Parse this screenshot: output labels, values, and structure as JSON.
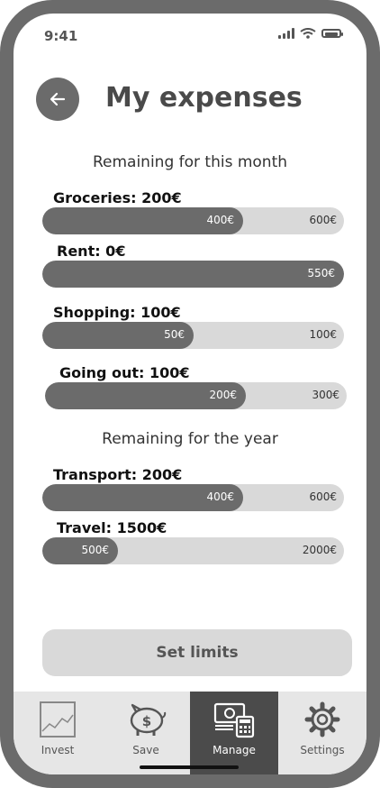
{
  "status_bar": {
    "time": "9:41"
  },
  "header": {
    "title": "My expenses"
  },
  "sections": [
    {
      "title": "Remaining for this month"
    },
    {
      "title": "Remaining for the year"
    }
  ],
  "expenses": [
    {
      "label": "Groceries: 200€",
      "used_label": "400€",
      "total_label": "600€",
      "used": 400,
      "total": 600
    },
    {
      "label": "Rent: 0€",
      "used_label": "550€",
      "total_label": "",
      "used": 550,
      "total": 550
    },
    {
      "label": "Shopping: 100€",
      "used_label": "50€",
      "total_label": "100€",
      "used": 50,
      "total": 100
    },
    {
      "label": "Going out: 100€",
      "used_label": "200€",
      "total_label": "300€",
      "used": 200,
      "total": 300
    },
    {
      "label": "Transport: 200€",
      "used_label": "400€",
      "total_label": "600€",
      "used": 400,
      "total": 600
    },
    {
      "label": "Travel: 1500€",
      "used_label": "500€",
      "total_label": "2000€",
      "used": 500,
      "total": 2000
    }
  ],
  "actions": {
    "set_limits_label": "Set limits"
  },
  "tabs": [
    {
      "label": "Invest",
      "icon": "chart-icon",
      "active": false
    },
    {
      "label": "Save",
      "icon": "piggy-bank-icon",
      "active": false
    },
    {
      "label": "Manage",
      "icon": "money-calculator-icon",
      "active": true
    },
    {
      "label": "Settings",
      "icon": "gear-icon",
      "active": false
    }
  ],
  "colors": {
    "accent": "#6b6b6b",
    "track": "#d9d9d9",
    "active_tab": "#4b4b4b"
  }
}
